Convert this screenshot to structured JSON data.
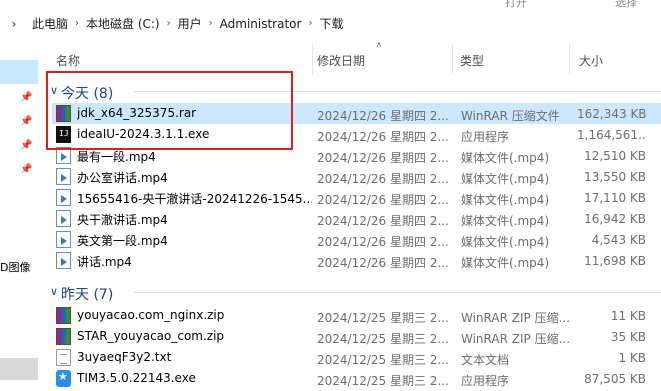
{
  "top_strip": {
    "left_fragment": "",
    "open_fragment": "打开",
    "select_fragment": "选择"
  },
  "address_bar": {
    "crumbs": [
      "此电脑",
      "本地磁盘 (C:)",
      "用户",
      "Administrator",
      "下载"
    ]
  },
  "sidebar": {
    "partial_label": "D图像"
  },
  "columns": {
    "name": "名称",
    "date": "修改日期",
    "type": "类型",
    "size": "大小"
  },
  "groups": {
    "today": {
      "label": "今天 (8)"
    },
    "yesterday": {
      "label": "昨天 (7)"
    }
  },
  "today_files": [
    {
      "name": "jdk_x64_325375.rar",
      "date": "2024/12/26 星期四 2...",
      "type": "WinRAR 压缩文件",
      "size": "162,343 KB",
      "icon": "winrar-icon",
      "selected": true
    },
    {
      "name": "ideaIU-2024.3.1.1.exe",
      "date": "2024/12/26 星期四 2...",
      "type": "应用程序",
      "size": "1,164,561...",
      "icon": "intellij-icon"
    },
    {
      "name": "最有一段.mp4",
      "date": "2024/12/26 星期四 2...",
      "type": "媒体文件(.mp4)",
      "size": "12,510 KB",
      "icon": "video-file-icon"
    },
    {
      "name": "办公室讲话.mp4",
      "date": "2024/12/26 星期四 2...",
      "type": "媒体文件(.mp4)",
      "size": "13,550 KB",
      "icon": "video-file-icon"
    },
    {
      "name": "15655416-央干澈讲话-20241226-1545...",
      "date": "2024/12/26 星期四 2...",
      "type": "媒体文件(.mp4)",
      "size": "17,110 KB",
      "icon": "video-file-icon"
    },
    {
      "name": "央干澈讲话.mp4",
      "date": "2024/12/26 星期四 2...",
      "type": "媒体文件(.mp4)",
      "size": "16,942 KB",
      "icon": "video-file-icon"
    },
    {
      "name": "英文第一段.mp4",
      "date": "2024/12/26 星期四 2...",
      "type": "媒体文件(.mp4)",
      "size": "4,543 KB",
      "icon": "video-file-icon"
    },
    {
      "name": "讲话.mp4",
      "date": "2024/12/26 星期四 2...",
      "type": "媒体文件(.mp4)",
      "size": "11,698 KB",
      "icon": "video-file-icon"
    }
  ],
  "yesterday_files": [
    {
      "name": "youyacao.com_nginx.zip",
      "date": "2024/12/25 星期三 2...",
      "type": "WinRAR ZIP 压缩...",
      "size": "11 KB",
      "icon": "zip-icon"
    },
    {
      "name": "STAR_youyacao_com.zip",
      "date": "2024/12/25 星期三 2...",
      "type": "WinRAR ZIP 压缩...",
      "size": "35 KB",
      "icon": "zip-icon"
    },
    {
      "name": "3uyaeqF3y2.txt",
      "date": "2024/12/25 星期三 2...",
      "type": "文本文档",
      "size": "1 KB",
      "icon": "text-file-icon"
    },
    {
      "name": "TIM3.5.0.22143.exe",
      "date": "2024/12/25 星期三 2...",
      "type": "应用程序",
      "size": "87,505 KB",
      "icon": "tim-icon"
    }
  ],
  "colors": {
    "selection": "#cce8ff",
    "group_header": "#1e3f8a",
    "annotation_box": "#e02020"
  }
}
